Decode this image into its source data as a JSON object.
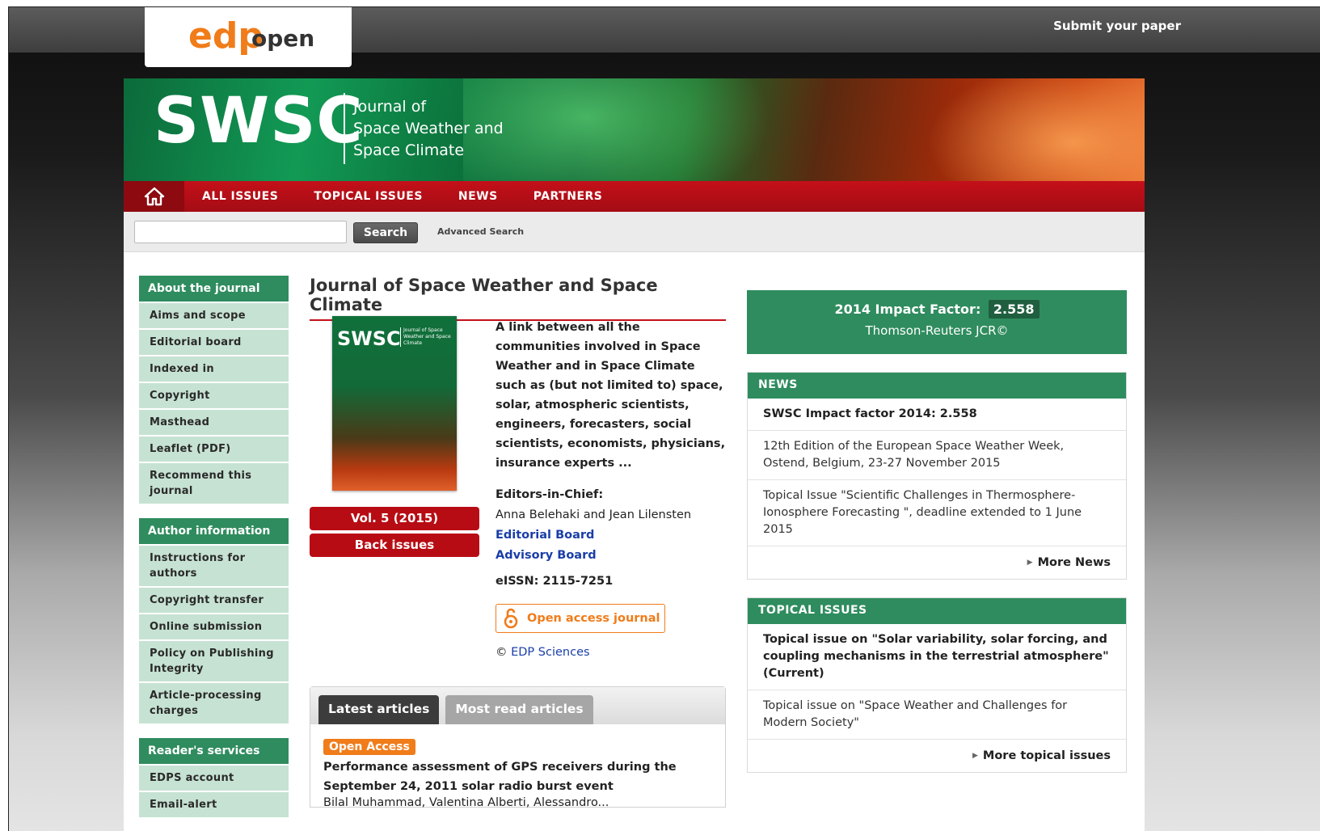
{
  "top": {
    "submit_label": "Submit your paper"
  },
  "banner": {
    "acronym": "SWSC",
    "subtitle_lines": [
      "Journal of",
      "Space Weather and",
      "Space Climate"
    ]
  },
  "nav": {
    "items": [
      {
        "label": "ALL ISSUES"
      },
      {
        "label": "TOPICAL ISSUES"
      },
      {
        "label": "NEWS"
      },
      {
        "label": "PARTNERS"
      }
    ]
  },
  "search": {
    "value": "",
    "button_label": "Search",
    "advanced_label": "Advanced Search"
  },
  "sidebar": {
    "sections": [
      {
        "title": "About the journal",
        "items": [
          "Aims and scope",
          "Editorial board",
          "Indexed in",
          "Copyright",
          "Masthead",
          "Leaflet (PDF)",
          "Recommend this journal"
        ]
      },
      {
        "title": "Author information",
        "items": [
          "Instructions for authors",
          "Copyright transfer",
          "Online submission",
          "Policy on Publishing Integrity",
          "Article-processing charges"
        ]
      },
      {
        "title": "Reader's services",
        "items": [
          "EDPS account",
          "Email-alert"
        ]
      }
    ]
  },
  "main": {
    "title": "Journal of Space Weather and Space Climate",
    "cover_acronym": "SWSC",
    "cover_subtitle": "Journal of Space Weather and Space Climate",
    "volume_label": "Vol. 5 (2015)",
    "back_issues_label": "Back issues",
    "description": "A link between all the communities involved in Space Weather and in Space Climate such as (but not limited to) space, solar, atmospheric scientists, engineers, forecasters, social scientists, economists, physicians, insurance experts ...",
    "editors_label": "Editors-in-Chief:",
    "editors_names": "Anna Belehaki and Jean Lilensten",
    "editorial_board_link": "Editorial Board",
    "advisory_board_link": "Advisory Board",
    "eissn": "eISSN: 2115-7251",
    "open_access_label": "Open access journal",
    "publisher_symbol": "©",
    "publisher_link": "EDP Sciences",
    "tabs": [
      {
        "label": "Latest articles",
        "active": true
      },
      {
        "label": "Most read articles",
        "active": false
      }
    ],
    "article": {
      "badge": "Open Access",
      "title": "Performance assessment of GPS receivers during the September 24, 2011 solar radio burst event",
      "authors": "Bilal Muhammad, Valentina Alberti, Alessandro..."
    }
  },
  "right": {
    "impact_label": "2014 Impact Factor:",
    "impact_value": "2.558",
    "impact_source": "Thomson-Reuters JCR©",
    "news": {
      "title": "NEWS",
      "items": [
        {
          "text": "SWSC Impact factor 2014: 2.558",
          "bold": true
        },
        {
          "text": "12th Edition of the European Space Weather Week, Ostend, Belgium, 23-27 November 2015",
          "bold": false
        },
        {
          "text": "Topical Issue \"Scientific Challenges in Thermosphere-Ionosphere Forecasting \", deadline extended to 1 June 2015",
          "bold": false
        }
      ],
      "more_label": "More News"
    },
    "topical": {
      "title": "TOPICAL ISSUES",
      "items": [
        {
          "text": "Topical issue on \"Solar variability, solar forcing, and coupling mechanisms in the terrestrial atmosphere\" (Current)",
          "bold": true
        },
        {
          "text": "Topical issue on \"Space Weather and Challenges for Modern Society\"",
          "bold": false
        }
      ],
      "more_label": "More topical issues"
    }
  },
  "colors": {
    "brand_green": "#2f8c5e",
    "brand_red": "#b80c14",
    "open_access_orange": "#f07c1a",
    "link_blue": "#1a3ea8"
  }
}
